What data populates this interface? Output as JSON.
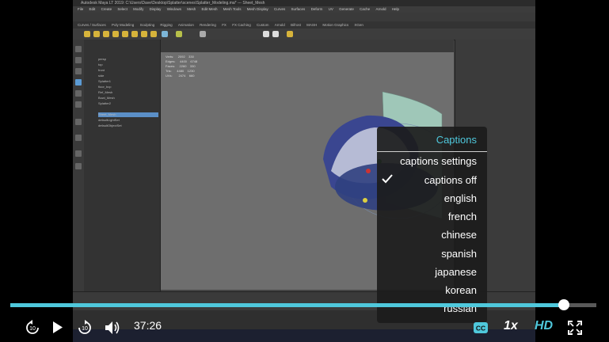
{
  "player": {
    "current_time": "37:26",
    "progress": 0.945,
    "speed_label": "1x",
    "quality_label": "HD",
    "accent_color": "#4fc8dc",
    "icons": {
      "rewind": "rewind-10-icon",
      "play": "play-icon",
      "forward": "forward-10-icon",
      "volume": "volume-icon",
      "captions": "cc-icon",
      "fullscreen": "fullscreen-icon"
    }
  },
  "captions_menu": {
    "title": "Captions",
    "selected": "captions off",
    "items": [
      {
        "label": "captions settings"
      },
      {
        "label": "captions off"
      },
      {
        "label": "english"
      },
      {
        "label": "french"
      },
      {
        "label": "chinese"
      },
      {
        "label": "spanish"
      },
      {
        "label": "japanese"
      },
      {
        "label": "korean"
      },
      {
        "label": "russian"
      }
    ]
  },
  "video": {
    "window_title": "Autodesk Maya LT 2019: C:\\Users\\Dave\\Desktop\\Splatter\\scenes\\Splatter_Modeling.ma* --- Sheet_Mesh",
    "menubar": [
      "File",
      "Edit",
      "Create",
      "Select",
      "Modify",
      "Display",
      "Windows",
      "Mesh",
      "Edit Mesh",
      "Mesh Tools",
      "Mesh Display",
      "Curves",
      "Surfaces",
      "Deform",
      "UV",
      "Generate",
      "Cache",
      "Arnold",
      "Help"
    ],
    "shelf_tabs": [
      "Curves / Surfaces",
      "Poly Modeling",
      "Sculpting",
      "Rigging",
      "Animation",
      "Rendering",
      "FX",
      "FX Caching",
      "Custom",
      "Arnold",
      "Bifrost",
      "MASH",
      "Motion Graphics",
      "XGen"
    ],
    "outliner_items": [
      "persp",
      "top",
      "front",
      "side",
      "Splatter1",
      "floor_bcp",
      "Ref_Mesh",
      "Bowl_Mesh",
      "Splatter2",
      "Sheet_Mesh",
      "defaultLightSet",
      "defaultObjectSet"
    ],
    "hud_text": "Verts:     2092    330\nEdges:     4400    6748\nFaces:     2260    330\nTris:      4480    1230\nUVs:       2474    660"
  }
}
